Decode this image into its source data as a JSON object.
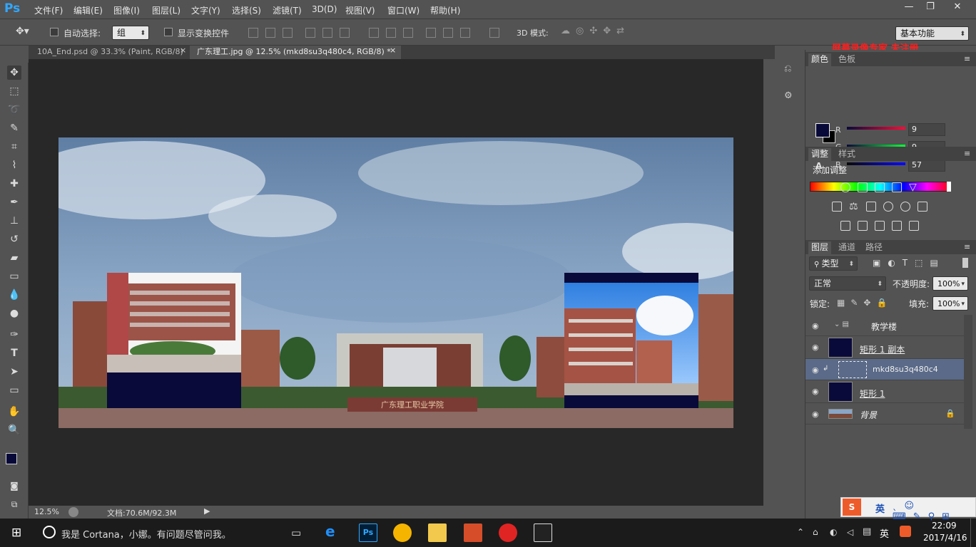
{
  "app": {
    "logo": "Ps"
  },
  "menu": [
    "文件(F)",
    "编辑(E)",
    "图像(I)",
    "图层(L)",
    "文字(Y)",
    "选择(S)",
    "滤镜(T)",
    "3D(D)",
    "视图(V)",
    "窗口(W)",
    "帮助(H)"
  ],
  "window_buttons": [
    "—",
    "❐",
    "✕"
  ],
  "options": {
    "auto_select_label": "自动选择:",
    "auto_select_value": "组",
    "show_transform_label": "显示变换控件",
    "mode_3d_label": "3D 模式:",
    "workspace_value": "基本功能",
    "watermark": "屏幕录像专家 未注册"
  },
  "tabs": [
    {
      "label": "10A_End.psd @ 33.3% (Paint, RGB/8)",
      "close": "×"
    },
    {
      "label": "广东理工.jpg @ 12.5% (mkd8su3q480c4, RGB/8) *",
      "close": "×"
    }
  ],
  "canvas": {
    "gate_text": "广东理工职业学院"
  },
  "status": {
    "zoom": "12.5%",
    "doc_size": "文档:70.6M/92.3M"
  },
  "color_panel": {
    "tabs": [
      "颜色",
      "色板"
    ],
    "r_label": "R",
    "g_label": "G",
    "b_label": "B",
    "r": "9",
    "g": "9",
    "b": "57",
    "fg_color": "#090939",
    "bg_color": "#000000"
  },
  "adjust_panel": {
    "tabs": [
      "调整",
      "样式"
    ],
    "title": "添加调整"
  },
  "layers_panel": {
    "tabs": [
      "图层",
      "通道",
      "路径"
    ],
    "filter_label": "类型",
    "blend_mode": "正常",
    "opacity_label": "不透明度:",
    "opacity": "100%",
    "lock_label": "锁定:",
    "fill_label": "填充:",
    "fill": "100%",
    "layers": [
      {
        "name": "教学楼",
        "kind": "group"
      },
      {
        "name": "矩形 1 副本",
        "kind": "shape"
      },
      {
        "name": "mkd8su3q480c4",
        "kind": "smart",
        "active": true
      },
      {
        "name": "矩形 1",
        "kind": "shape"
      },
      {
        "name": "背景",
        "kind": "background"
      }
    ]
  },
  "taskbar": {
    "search": "我是 Cortana，小娜。有问题尽管问我。",
    "ime": "英",
    "time": "22:09",
    "date": "2017/4/16",
    "ime_tray": "英"
  }
}
